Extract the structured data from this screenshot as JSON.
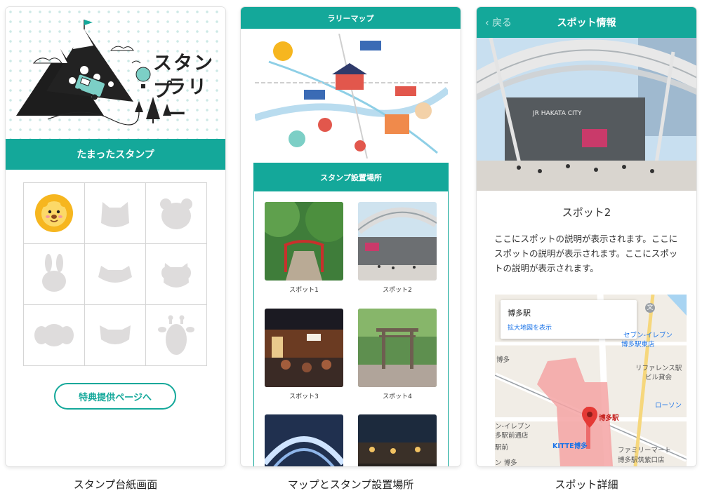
{
  "screen1": {
    "hero_title_line1": "スタンプ",
    "hero_title_line2": "ラリー",
    "section_title": "たまったスタンプ",
    "stamps": [
      "lion",
      "cat",
      "bear",
      "rabbit",
      "fox",
      "dog",
      "elephant",
      "tanuki",
      "giraffe"
    ],
    "benefit_button": "特典提供ページへ",
    "caption": "スタンプ台紙画面"
  },
  "screen2": {
    "header_title": "ラリーマップ",
    "stamp_locations_title": "スタンプ設置場所",
    "spots": [
      {
        "label": "スポット1",
        "photo": "shrine-steps-photo"
      },
      {
        "label": "スポット2",
        "photo": "station-plaza-photo"
      },
      {
        "label": "スポット3",
        "photo": "food-stalls-photo"
      },
      {
        "label": "スポット4",
        "photo": "torii-gate-photo"
      },
      {
        "label": "",
        "photo": "illumination-photo"
      },
      {
        "label": "",
        "photo": "night-street-photo"
      }
    ],
    "caption": "マップとスタンプ設置場所"
  },
  "screen3": {
    "back_label": "戻る",
    "header_title": "スポット情報",
    "spot_name": "スポット2",
    "description": "ここにスポットの説明が表示されます。ここにスポットの説明が表示されます。ここにスポットの説明が表示されます。",
    "photo_sign": "JR HAKATA CITY",
    "map": {
      "place_name": "博多駅",
      "view_larger": "拡大地図を表示",
      "labels": {
        "seven_eleven": "セブン-イレブン",
        "seven_eleven_sub": "博多駅東店",
        "area_hakata": "博多",
        "reference": "リファレンス駅",
        "reference_sub": "ビル貸会",
        "lawson": "ローソン",
        "pin_label": "博多駅",
        "seven_left": "ン-イレブン",
        "seven_left_sub": "多駅前通店",
        "kitte": "KITTE博多",
        "familymart": "ファミリーマート",
        "familymart_sub": "博多駅筑紫口店",
        "left_station": "駅前",
        "bottom_left": "ン 博多"
      }
    },
    "caption": "スポット詳細"
  },
  "colors": {
    "accent": "#14a89a",
    "stamp_placeholder": "#dedcdc",
    "lion": "#f6b61f"
  }
}
